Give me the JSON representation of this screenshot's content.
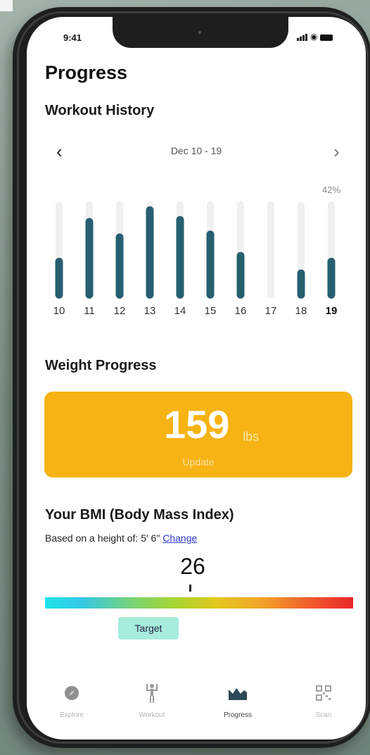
{
  "status_bar": {
    "time": "9:41"
  },
  "page_title": "Progress",
  "workout_history": {
    "title": "Workout History",
    "date_range": "Dec 10 - 19",
    "prev_icon": "chevron-left-icon",
    "next_icon": "chevron-right-icon",
    "percent_label": "42%"
  },
  "chart_data": {
    "type": "bar",
    "categories": [
      "10",
      "11",
      "12",
      "13",
      "14",
      "15",
      "16",
      "17",
      "18",
      "19"
    ],
    "values": [
      42,
      83,
      67,
      95,
      85,
      70,
      48,
      0,
      30,
      42
    ],
    "highlight": "19",
    "ylim": [
      0,
      100
    ],
    "bar_color": "#265f70",
    "track_color": "#f0f0f0"
  },
  "weight_progress": {
    "title": "Weight Progress",
    "value": "159",
    "unit": "lbs",
    "update_label": "Update",
    "card_color": "#f7b313"
  },
  "bmi": {
    "title": "Your BMI (Body Mass Index)",
    "height_text": "Based on a height of: 5' 6\"",
    "change_link": "Change",
    "value": "26",
    "target_label": "Target"
  },
  "tab_bar": [
    {
      "label": "Explore",
      "icon": "compass-icon"
    },
    {
      "label": "Workout",
      "icon": "person-weights-icon"
    },
    {
      "label": "Progress",
      "icon": "chart-icon",
      "active": true
    },
    {
      "label": "Scan",
      "icon": "qr-code-icon"
    }
  ]
}
